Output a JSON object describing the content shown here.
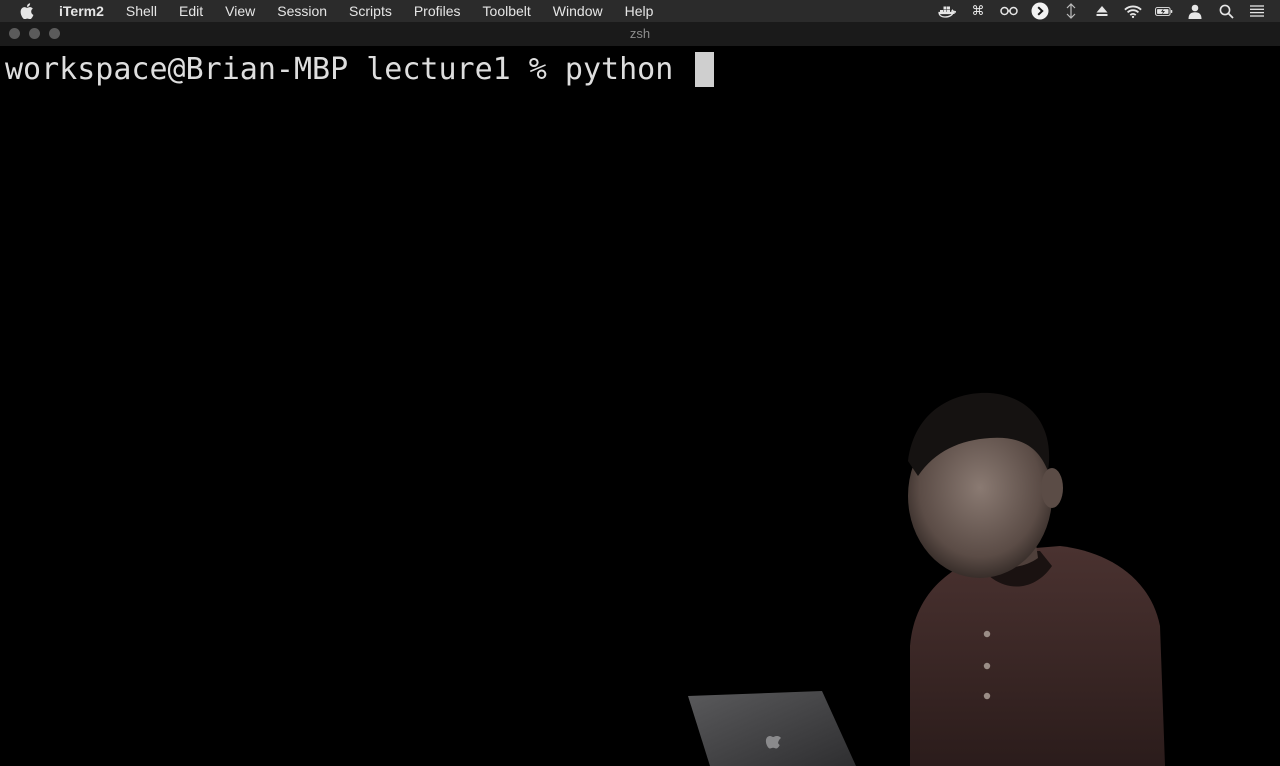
{
  "menubar": {
    "app_name": "iTerm2",
    "items": [
      "Shell",
      "Edit",
      "View",
      "Session",
      "Scripts",
      "Profiles",
      "Toolbelt",
      "Window",
      "Help"
    ],
    "status_icons": [
      "docker-icon",
      "command-icon",
      "glasses-icon",
      "play-circle-icon",
      "nudge-icon",
      "eject-icon",
      "wifi-icon",
      "battery-icon",
      "user-icon",
      "search-icon",
      "control-center-icon"
    ]
  },
  "window": {
    "title": "zsh"
  },
  "terminal": {
    "prompt": "workspace@Brian-MBP lecture1 % ",
    "command": "python "
  }
}
